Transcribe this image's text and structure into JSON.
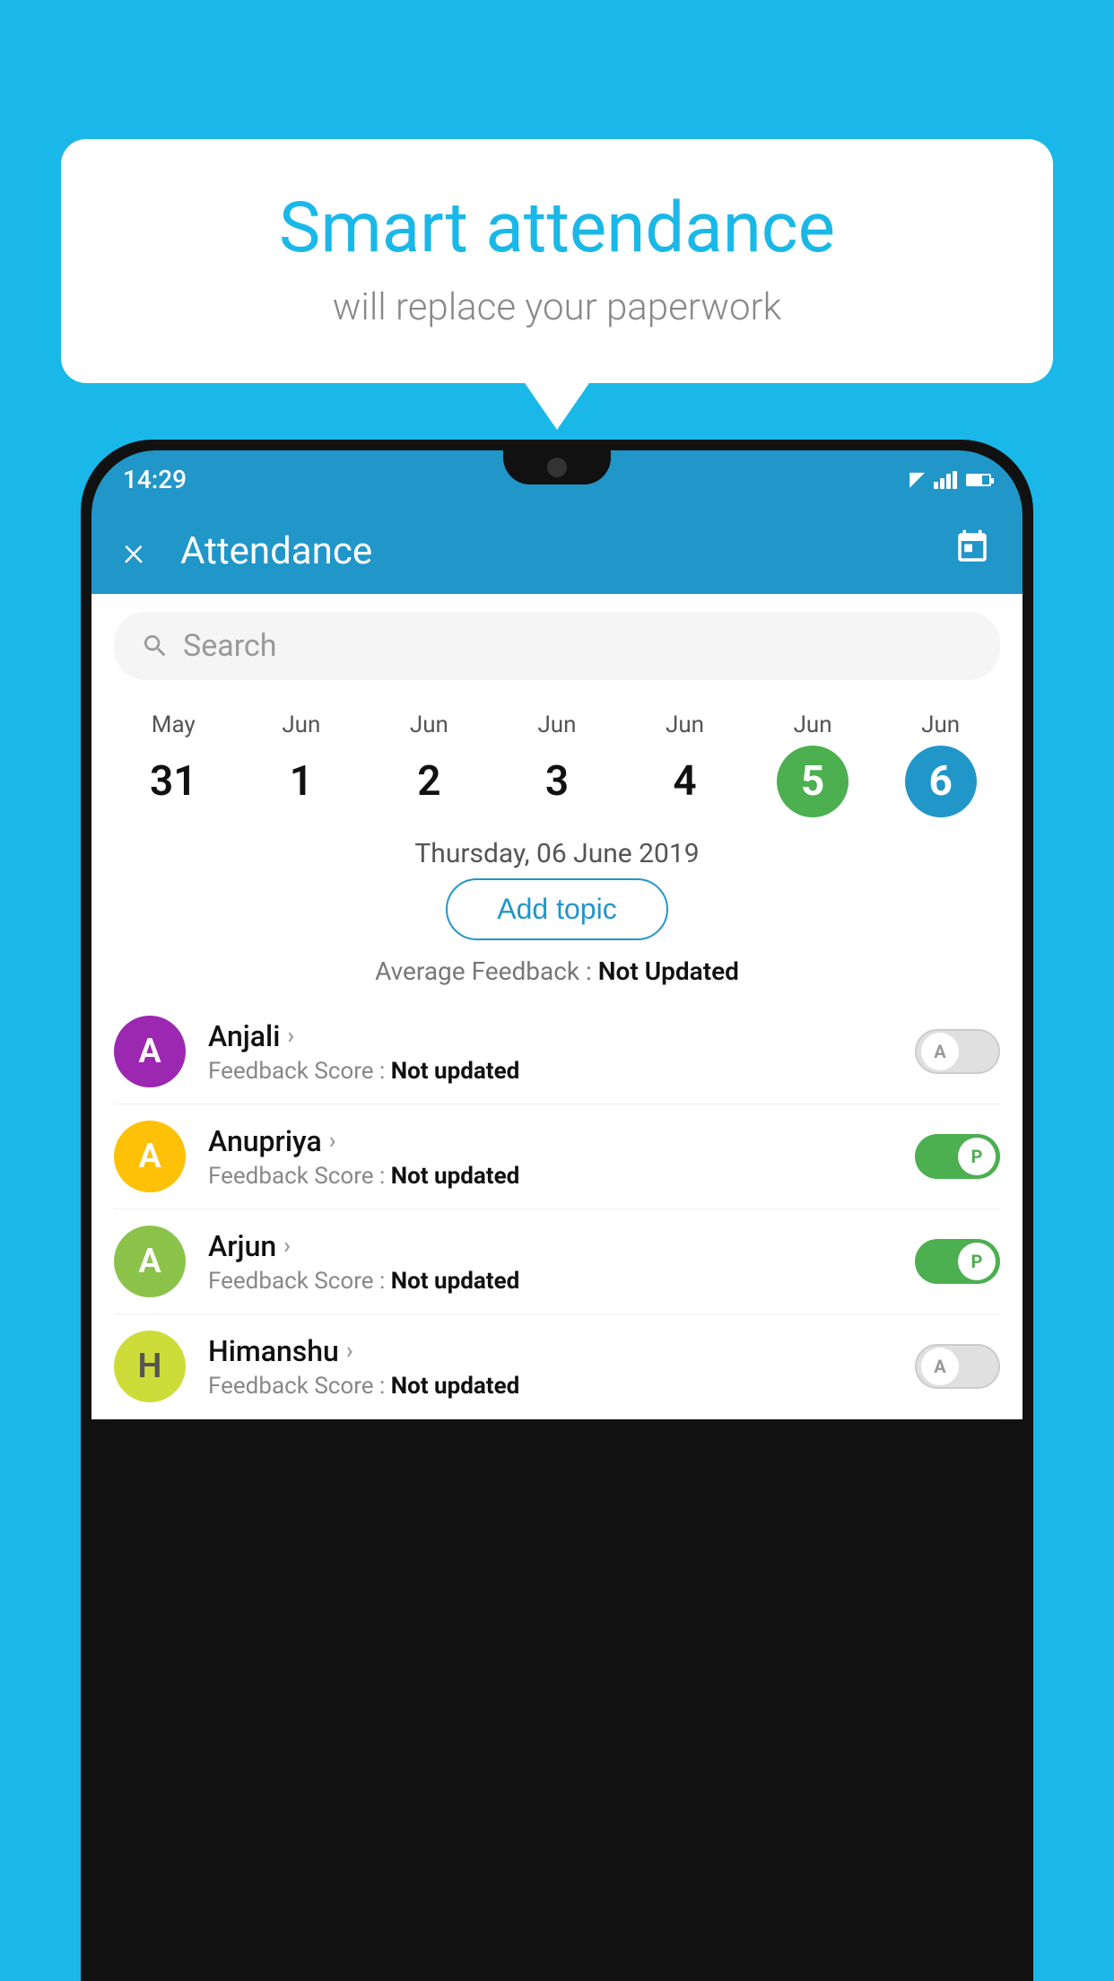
{
  "background_color": "#1ab8e8",
  "speech_bubble": {
    "title": "Smart attendance",
    "subtitle": "will replace your paperwork"
  },
  "status_bar": {
    "time": "14:29",
    "wifi": "▲",
    "signal": "▲",
    "battery": "▐"
  },
  "app_bar": {
    "title": "Attendance",
    "close_label": "×",
    "calendar_icon": "📅"
  },
  "search": {
    "placeholder": "Search"
  },
  "calendar": {
    "months": [
      "May",
      "Jun",
      "Jun",
      "Jun",
      "Jun",
      "Jun",
      "Jun"
    ],
    "days": [
      "31",
      "1",
      "2",
      "3",
      "4",
      "5",
      "6"
    ],
    "selected_green": 5,
    "selected_blue": 6
  },
  "date_header": "Thursday, 06 June 2019",
  "add_topic_label": "Add topic",
  "avg_feedback_label": "Average Feedback :",
  "avg_feedback_value": "Not Updated",
  "students": [
    {
      "name": "Anjali",
      "avatar_letter": "A",
      "avatar_color": "purple",
      "feedback_label": "Feedback Score :",
      "feedback_value": "Not updated",
      "toggle_state": "off",
      "toggle_label": "A"
    },
    {
      "name": "Anupriya",
      "avatar_letter": "A",
      "avatar_color": "yellow",
      "feedback_label": "Feedback Score :",
      "feedback_value": "Not updated",
      "toggle_state": "on",
      "toggle_label": "P"
    },
    {
      "name": "Arjun",
      "avatar_letter": "A",
      "avatar_color": "green",
      "feedback_label": "Feedback Score :",
      "feedback_value": "Not updated",
      "toggle_state": "on",
      "toggle_label": "P"
    },
    {
      "name": "Himanshu",
      "avatar_letter": "H",
      "avatar_color": "olive",
      "feedback_label": "Feedback Score :",
      "feedback_value": "Not updated",
      "toggle_state": "off",
      "toggle_label": "A"
    }
  ]
}
